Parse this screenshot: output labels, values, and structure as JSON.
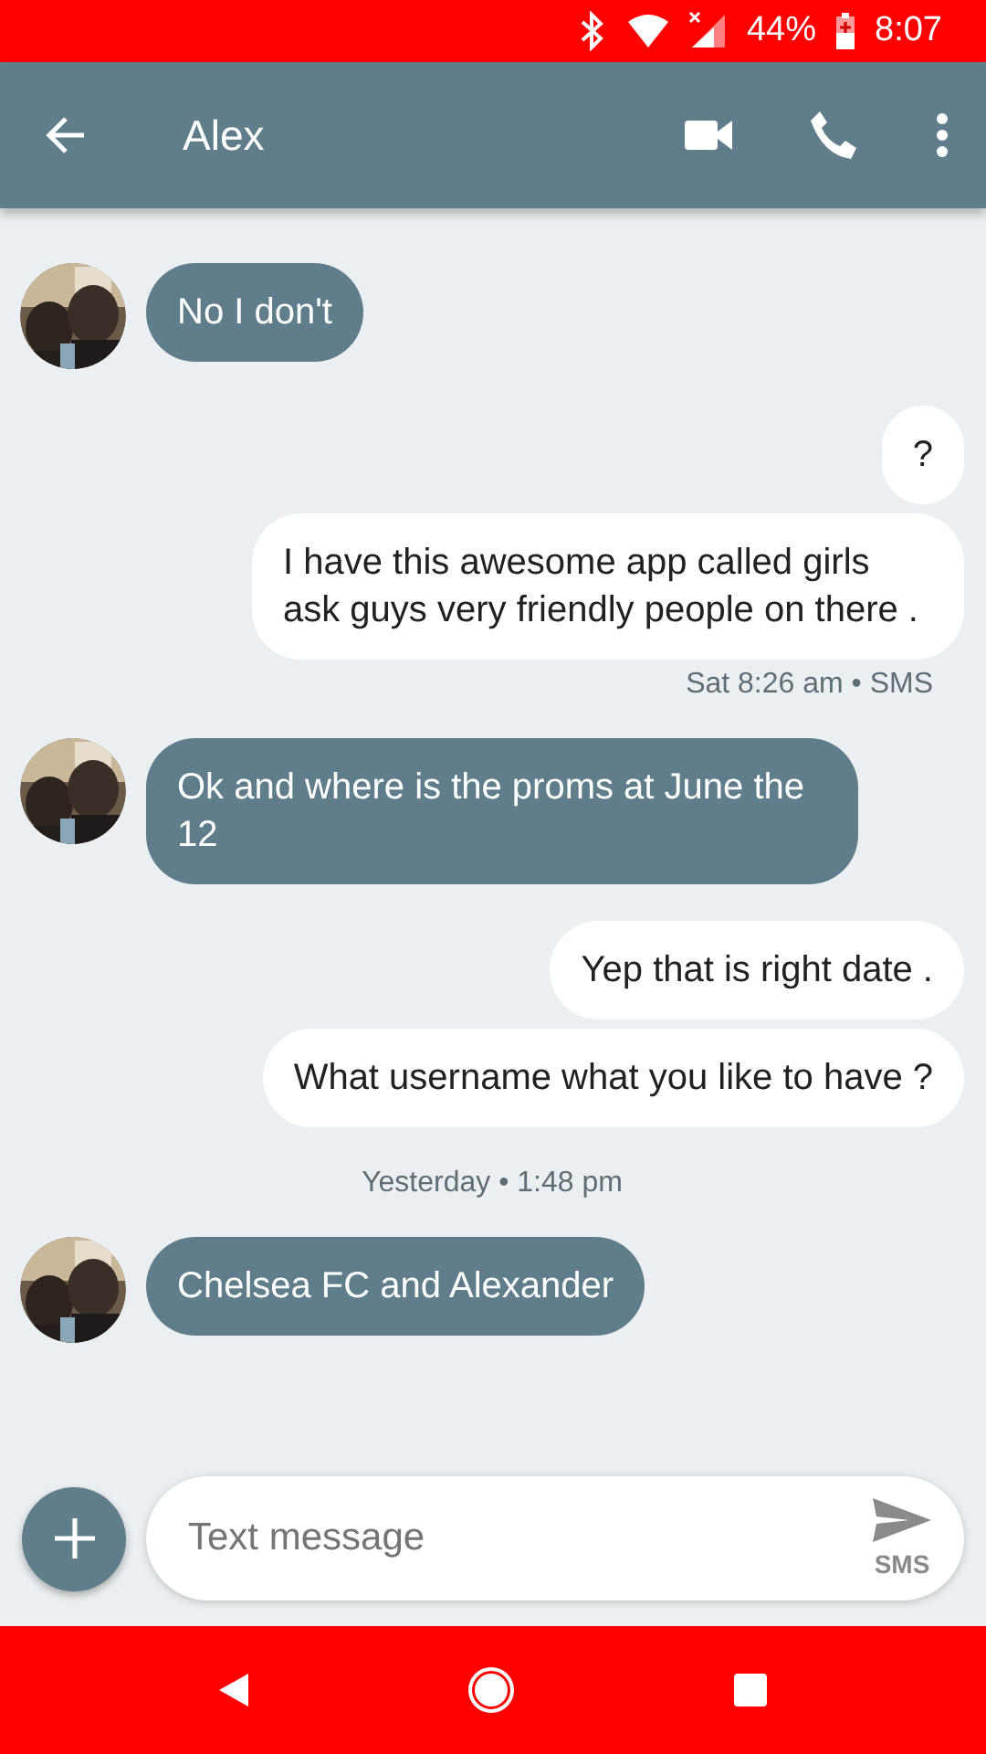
{
  "status_bar": {
    "battery": "44%",
    "time": "8:07"
  },
  "app_bar": {
    "title": "Alex"
  },
  "messages": [
    {
      "kind": "incoming",
      "text": "No I don't"
    },
    {
      "kind": "outgoing",
      "text": "?"
    },
    {
      "kind": "outgoing",
      "text": "I have this awesome app called girls ask guys very friendly people on there .",
      "meta": "Sat 8:26 am • SMS"
    },
    {
      "kind": "incoming",
      "text": "Ok and where is the proms at June the 12"
    },
    {
      "kind": "outgoing",
      "text": "Yep that is right date ."
    },
    {
      "kind": "outgoing",
      "text": "What username what you like to have ?"
    },
    {
      "kind": "separator",
      "text": "Yesterday • 1:48 pm"
    },
    {
      "kind": "incoming",
      "text": "Chelsea FC and Alexander"
    }
  ],
  "composer": {
    "placeholder": "Text message",
    "send_label": "SMS"
  }
}
